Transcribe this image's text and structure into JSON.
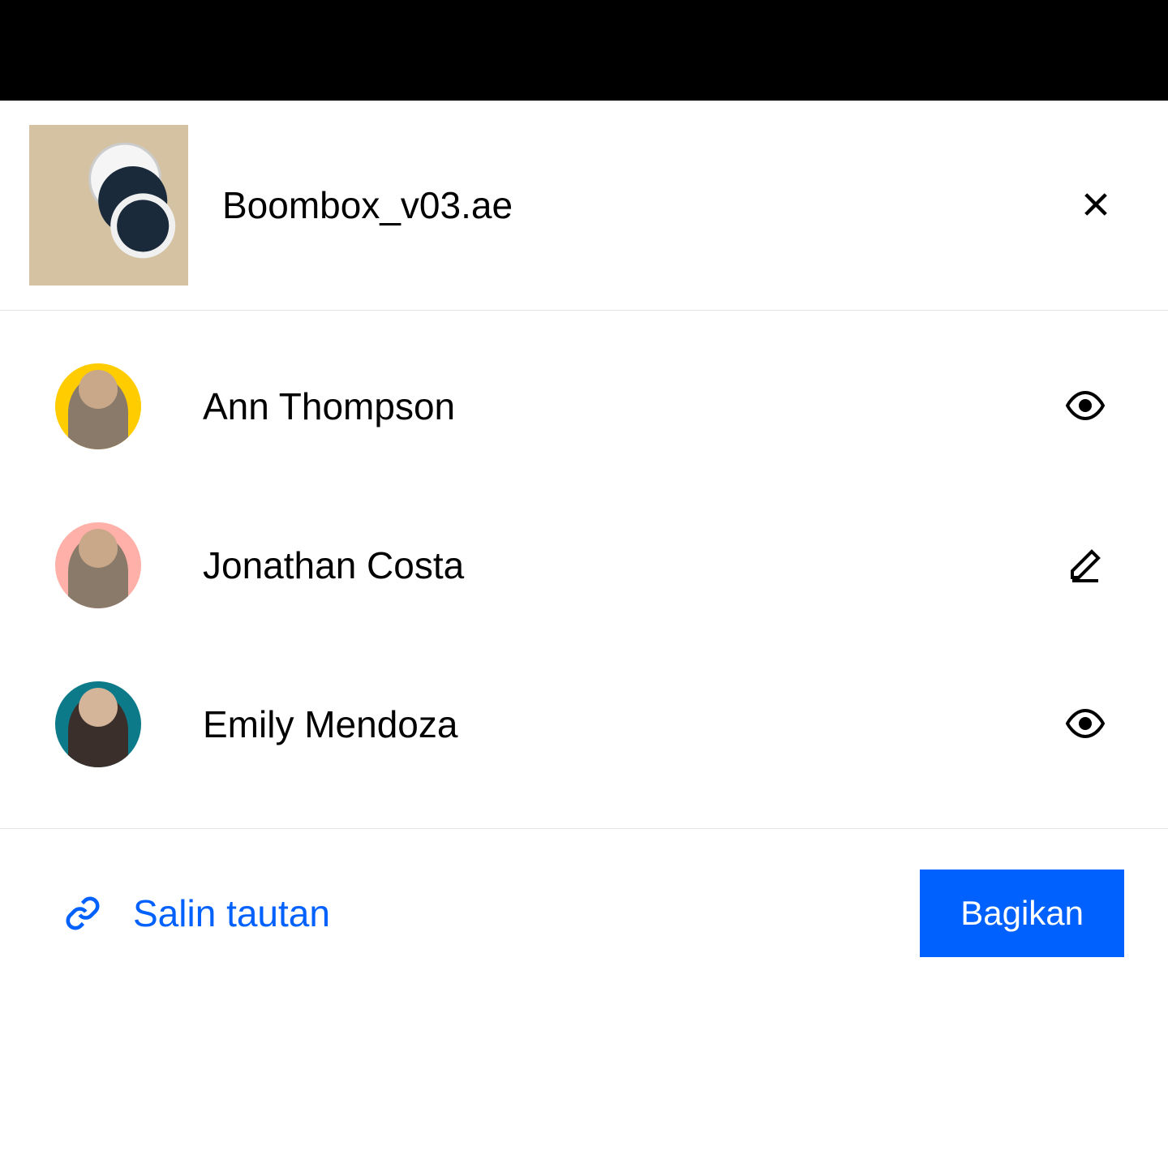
{
  "file": {
    "name": "Boombox_v03.ae"
  },
  "users": [
    {
      "name": "Ann Thompson",
      "permission": "view"
    },
    {
      "name": "Jonathan Costa",
      "permission": "edit"
    },
    {
      "name": "Emily Mendoza",
      "permission": "view"
    }
  ],
  "actions": {
    "copy_link": "Salin tautan",
    "share": "Bagikan"
  }
}
